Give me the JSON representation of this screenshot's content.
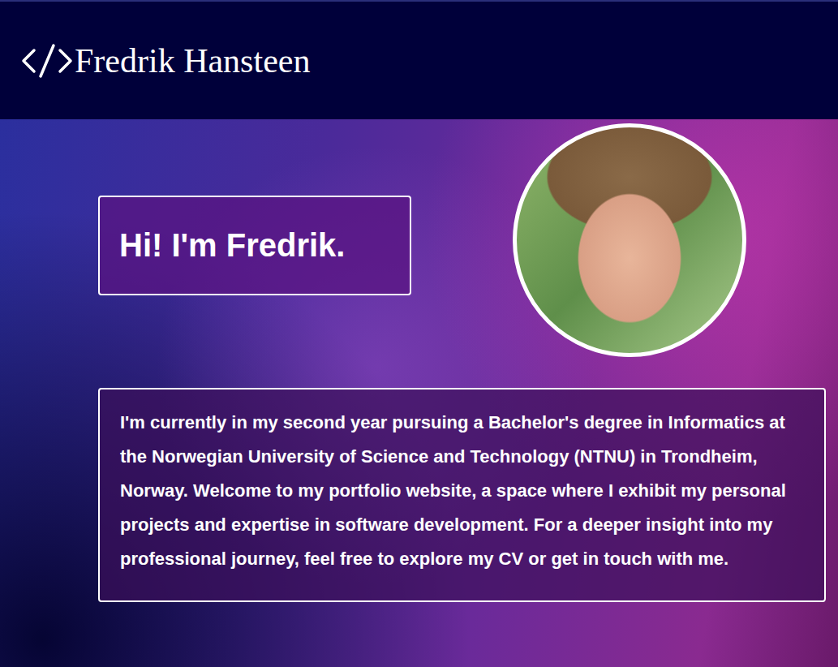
{
  "header": {
    "name": "Fredrik Hansteen"
  },
  "hero": {
    "title": "Hi! I'm Fredrik."
  },
  "intro": {
    "text": "I'm currently in my second year pursuing a Bachelor's degree in Informatics at the Norwegian University of Science and Technology (NTNU) in Trondheim, Norway. Welcome to my portfolio website, a space where I exhibit my personal projects and expertise in software development. For a deeper insight into my professional journey, feel free to explore my CV or get in touch with me."
  }
}
